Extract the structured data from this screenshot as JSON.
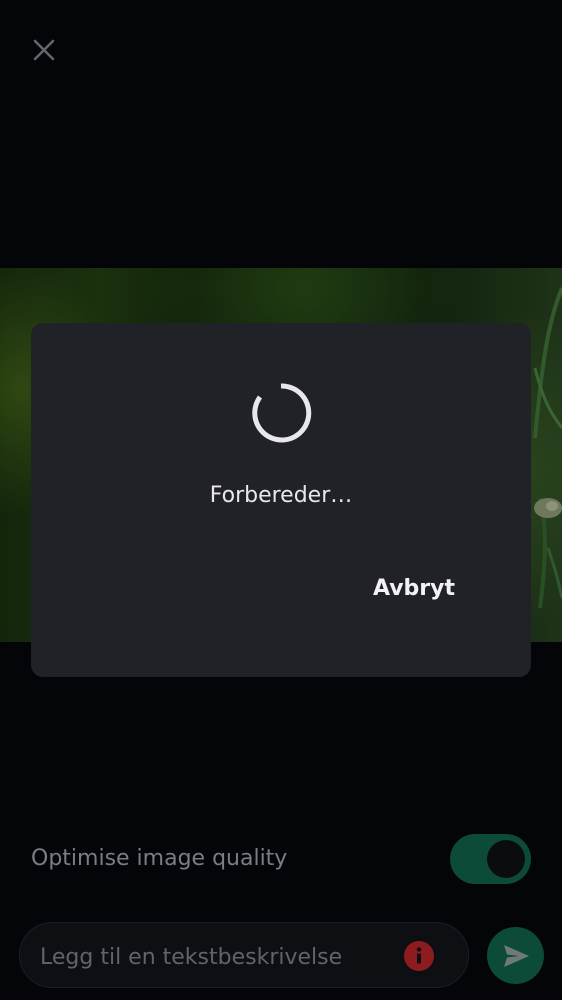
{
  "toolbar": {
    "close_icon": "close-icon"
  },
  "dialog": {
    "message": "Forbereder…",
    "cancel_label": "Avbryt",
    "spinner_icon": "loading-spinner"
  },
  "options": {
    "optimise_label": "Optimise image quality",
    "optimise_enabled": true
  },
  "composer": {
    "caption_placeholder": "Legg til en tekstbeskrivelse",
    "caption_value": "",
    "info_icon": "info-icon",
    "send_icon": "send-icon"
  },
  "colors": {
    "background": "#07090d",
    "dialog": "#212227",
    "accent": "#0c4a3a",
    "warning": "#8e1c1f"
  }
}
